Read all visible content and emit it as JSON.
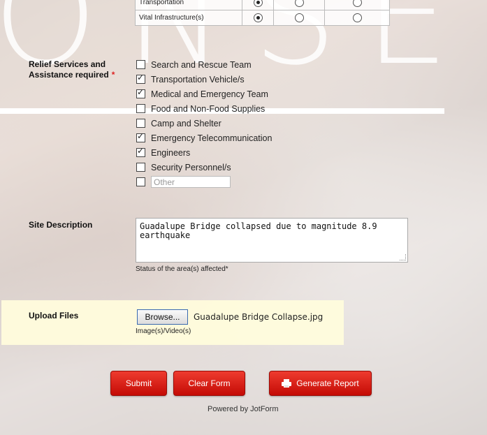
{
  "background_word": "ONSE",
  "grid": {
    "rows": [
      {
        "label": "Transportation",
        "selected": 0
      },
      {
        "label": "Vital Infrastructure(s)",
        "selected": 0
      }
    ]
  },
  "relief": {
    "label": "Relief Services and Assistance required",
    "required_mark": "*",
    "items": [
      {
        "label": "Search and Rescue Team",
        "checked": false
      },
      {
        "label": "Transportation Vehicle/s",
        "checked": true
      },
      {
        "label": "Medical and Emergency Team",
        "checked": true
      },
      {
        "label": "Food and Non-Food Supplies",
        "checked": false
      },
      {
        "label": "Camp and Shelter",
        "checked": false
      },
      {
        "label": "Emergency Telecommunication",
        "checked": true
      },
      {
        "label": "Engineers",
        "checked": true
      },
      {
        "label": "Security Personnel/s",
        "checked": false
      }
    ],
    "other_placeholder": "Other"
  },
  "site": {
    "label": "Site Description",
    "value": "Guadalupe Bridge collapsed due to magnitude 8.9 earthquake",
    "sublabel": "Status of the area(s) affected*"
  },
  "upload": {
    "label": "Upload Files",
    "browse_label": "Browse...",
    "filename": "Guadalupe Bridge Collapse.jpg",
    "sublabel": "Image(s)/Video(s)"
  },
  "buttons": {
    "submit": "Submit",
    "clear": "Clear Form",
    "report": "Generate Report"
  },
  "footer": "Powered by JotForm",
  "colors": {
    "button": "#d81c12",
    "upload_band": "#fffcdc",
    "required": "#dd2222"
  }
}
